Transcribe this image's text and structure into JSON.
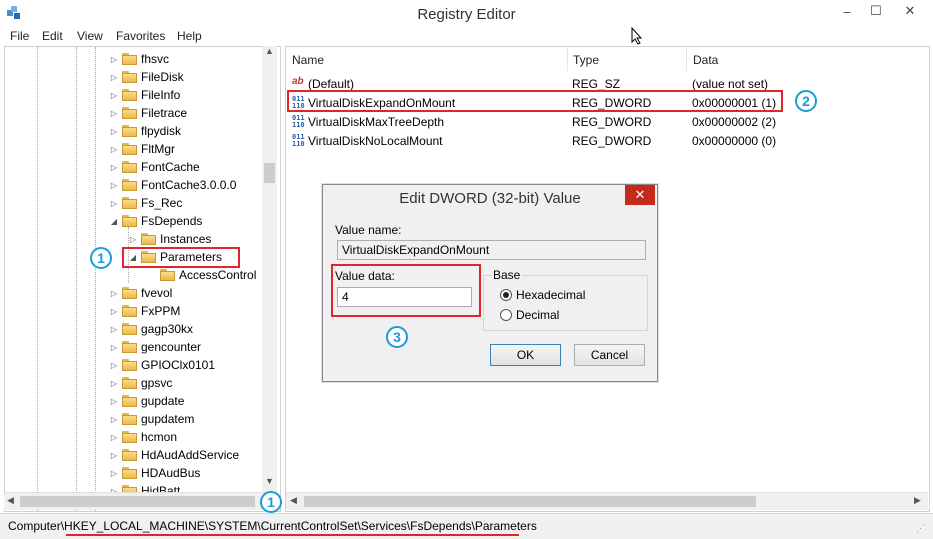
{
  "window": {
    "title": "Registry Editor",
    "minimize": "–",
    "maximize": "☐",
    "close": "✕"
  },
  "menu": [
    "File",
    "Edit",
    "View",
    "Favorites",
    "Help"
  ],
  "tree": [
    {
      "label": "fhsvc",
      "arrow": "▷"
    },
    {
      "label": "FileDisk",
      "arrow": "▷"
    },
    {
      "label": "FileInfo",
      "arrow": "▷"
    },
    {
      "label": "Filetrace",
      "arrow": "▷"
    },
    {
      "label": "flpydisk",
      "arrow": "▷"
    },
    {
      "label": "FltMgr",
      "arrow": "▷"
    },
    {
      "label": "FontCache",
      "arrow": "▷"
    },
    {
      "label": "FontCache3.0.0.0",
      "arrow": "▷"
    },
    {
      "label": "Fs_Rec",
      "arrow": "▷"
    },
    {
      "label": "FsDepends",
      "arrow": "◢"
    },
    {
      "label": "Instances",
      "arrow": "▷"
    },
    {
      "label": "Parameters",
      "arrow": "◢"
    },
    {
      "label": "AccessControl",
      "arrow": ""
    },
    {
      "label": "fvevol",
      "arrow": "▷"
    },
    {
      "label": "FxPPM",
      "arrow": "▷"
    },
    {
      "label": "gagp30kx",
      "arrow": "▷"
    },
    {
      "label": "gencounter",
      "arrow": "▷"
    },
    {
      "label": "GPIOClx0101",
      "arrow": "▷"
    },
    {
      "label": "gpsvc",
      "arrow": "▷"
    },
    {
      "label": "gupdate",
      "arrow": "▷"
    },
    {
      "label": "gupdatem",
      "arrow": "▷"
    },
    {
      "label": "hcmon",
      "arrow": "▷"
    },
    {
      "label": "HdAudAddService",
      "arrow": "▷"
    },
    {
      "label": "HDAudBus",
      "arrow": "▷"
    },
    {
      "label": "HidBatt",
      "arrow": "▷"
    }
  ],
  "list": {
    "headers": {
      "name": "Name",
      "type": "Type",
      "data": "Data"
    },
    "rows": [
      {
        "name": "(Default)",
        "type": "REG_SZ",
        "data": "(value not set)",
        "icon": "ab"
      },
      {
        "name": "VirtualDiskExpandOnMount",
        "type": "REG_DWORD",
        "data": "0x00000001 (1)",
        "icon": "dword"
      },
      {
        "name": "VirtualDiskMaxTreeDepth",
        "type": "REG_DWORD",
        "data": "0x00000002 (2)",
        "icon": "dword"
      },
      {
        "name": "VirtualDiskNoLocalMount",
        "type": "REG_DWORD",
        "data": "0x00000000 (0)",
        "icon": "dword"
      }
    ]
  },
  "dialog": {
    "title": "Edit DWORD (32-bit) Value",
    "close": "✕",
    "value_name_label": "Value name:",
    "value_name": "VirtualDiskExpandOnMount",
    "value_data_label": "Value data:",
    "value_data": "4",
    "base_label": "Base",
    "hex_label": "Hexadecimal",
    "dec_label": "Decimal",
    "base_selected": "Hexadecimal",
    "ok": "OK",
    "cancel": "Cancel"
  },
  "status": {
    "path": "Computer\\HKEY_LOCAL_MACHINE\\SYSTEM\\CurrentControlSet\\Services\\FsDepends\\Parameters"
  },
  "callouts": {
    "c1_tree": "1",
    "c1_status": "1",
    "c2": "2",
    "c3": "3"
  },
  "colors": {
    "highlight_red": "#e0252f",
    "callout_blue": "#1c9bd8"
  }
}
